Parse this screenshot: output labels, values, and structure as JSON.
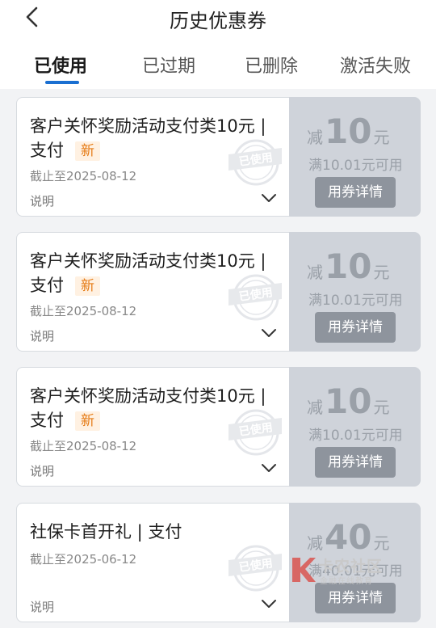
{
  "header": {
    "title": "历史优惠券"
  },
  "tabs": [
    {
      "label": "已使用",
      "active": true
    },
    {
      "label": "已过期",
      "active": false
    },
    {
      "label": "已删除",
      "active": false
    },
    {
      "label": "激活失败",
      "active": false
    }
  ],
  "coupons": [
    {
      "name": "客户关怀奖励活动支付类10元 | 支付",
      "badge": "新",
      "expire": "截止至2025-08-12",
      "desc_label": "说明",
      "amount_prefix": "减",
      "amount": "10",
      "amount_unit": "元",
      "condition": "满10.01元可用",
      "detail_button": "用券详情",
      "stamp_text": "已使用"
    },
    {
      "name": "客户关怀奖励活动支付类10元 | 支付",
      "badge": "新",
      "expire": "截止至2025-08-12",
      "desc_label": "说明",
      "amount_prefix": "减",
      "amount": "10",
      "amount_unit": "元",
      "condition": "满10.01元可用",
      "detail_button": "用券详情",
      "stamp_text": "已使用"
    },
    {
      "name": "客户关怀奖励活动支付类10元 | 支付",
      "badge": "新",
      "expire": "截止至2025-08-12",
      "desc_label": "说明",
      "amount_prefix": "减",
      "amount": "10",
      "amount_unit": "元",
      "condition": "满10.01元可用",
      "detail_button": "用券详情",
      "stamp_text": "已使用"
    },
    {
      "name": "社保卡首开礼 | 支付",
      "badge": "",
      "expire": "截止至2025-06-12",
      "desc_label": "说明",
      "amount_prefix": "减",
      "amount": "40",
      "amount_unit": "元",
      "condition": "满40.01元可用",
      "detail_button": "用券详情",
      "stamp_text": "已使用"
    }
  ],
  "watermark": {
    "text": "卡农社区",
    "sub": "金融在线教育"
  },
  "colors": {
    "accent": "#1a6fd1",
    "badge_text": "#e57a14",
    "badge_bg": "#fff1e2",
    "used_panel": "#cfd3da",
    "used_button": "#8e949d"
  }
}
